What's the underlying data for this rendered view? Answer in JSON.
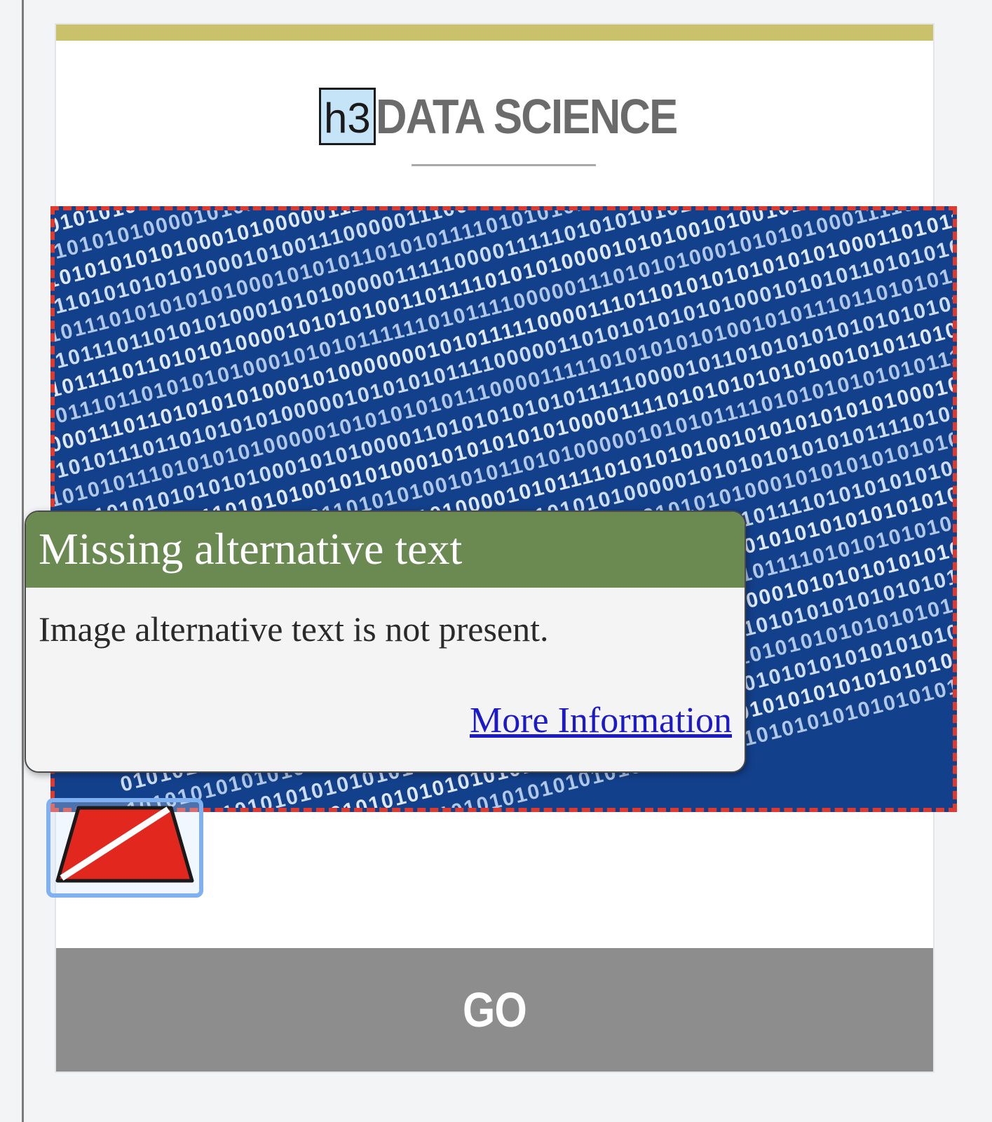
{
  "heading": {
    "tag_label": "h3",
    "title": "DATA SCIENCE"
  },
  "image": {
    "binary_rows": [
      "0101010101010001010101000001111000000111101010101010101010101010101010100",
      "1010101010100010101010110011110000011111010101101010101000101010111101010",
      "0110101010100010101010111111010111110101010101010101000101010111101101011",
      "1011010101010100011111010000001111110000011010101010101001010110101100101",
      "0101101010101010001010101001111100000111010101010000010101001011010101101",
      "1011010101010000101010100110101111101010101010101010101000101011111010101",
      "1101101010101010001010000011110000011111011010101000101000101110101101101",
      "0110110101010101000101001110000011100001101010100001010101000011110101101",
      "1011011101010101010001010101101010111101010101010101000010101010111101011",
      "0101011101101010100010101000001111100001111101010101010101001011010101010",
      "0010111101101010100001010101001101111010101000010101001010010111001101010",
      "0001110110101010100010101011111101011110000011101010100010101010001111010",
      "1000111011010101010001010000000101011111000011101101010101010101000110101",
      "0101011101101010101000001010101011110000011010101010101000101010110101010",
      "1010101110101010100000101010101011100001111101010101010010101110110101010",
      "0101010101010101000101010000110101010101011111000010110101010101010101011",
      "1010101010111010101001010100010101010101000011110101010101010010101101010",
      "0101101010101000101011010101001010110101000001010101111010101010101011101",
      "1011010101010101000101010101010000101011110101010100101010101010100010101",
      "0101010111010101010101000010101010111010101000001010101010101011110101010",
      "1010101010101010001010101101010100001010111101010101000101010101010101011",
      "0101010101011101010100101010101010101010000101010101011110101010101000101",
      "1010101010101010111010101000101010101011110101010000101010101010101010101",
      "0101010101010101010101011110101010101000101010101010111101010101010101010",
      "1010101010101010101010101010101011110101010101010100010101010101010101010",
      "0101010101010101010101010101010101010101010101010101010101010101010101010",
      "1010101010101010101010101010101010101010101010101010101010101010101010101",
      "0101010101010101010101010101010101010101010101010101010101010101010101010",
      "1010101010101010101010101010101010101010101010101010101010101010101010101",
      "0101010101010101010101010101010101010101010101010101010101010101010101010"
    ]
  },
  "tooltip": {
    "title": "Missing alternative text",
    "body": "Image alternative text is not present.",
    "link_label": "More Information"
  },
  "broken_image": {
    "icon": "broken-image-icon",
    "colors": {
      "fill": "#e2281e",
      "stroke": "#1a1a1a",
      "slash": "#ffffff"
    }
  },
  "go_button": {
    "label": "GO"
  },
  "colors": {
    "accent_bar": "#c9c26a",
    "tooltip_header": "#6a8a52",
    "error_dash": "#e03a2e",
    "image_bg": "#13408b",
    "link": "#1b19c8",
    "go_bg": "#8d8d8d"
  }
}
